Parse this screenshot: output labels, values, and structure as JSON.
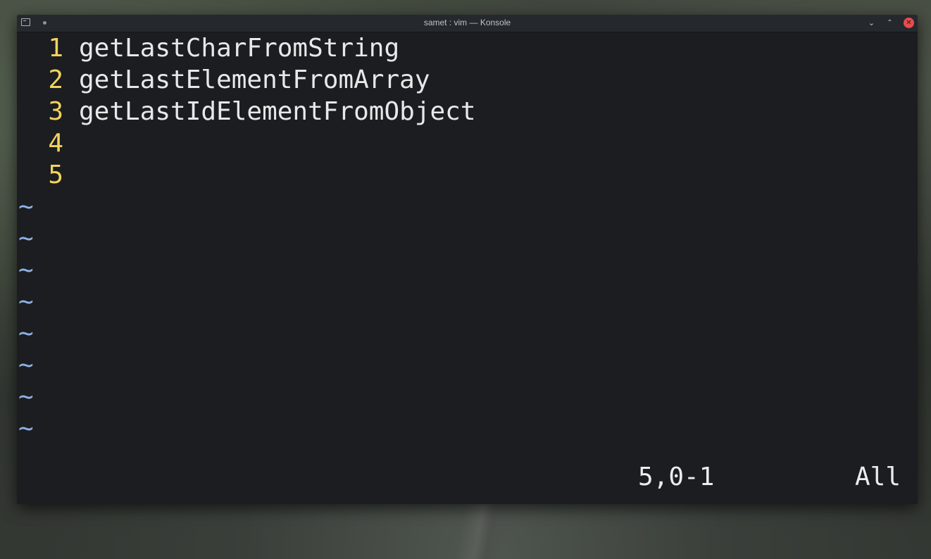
{
  "window": {
    "title": "samet : vim — Konsole",
    "controls": {
      "minimize": "⌄",
      "maximize": "⌃",
      "close": "✕"
    }
  },
  "editor": {
    "lines": [
      {
        "number": "1",
        "text": "getLastCharFromString"
      },
      {
        "number": "2",
        "text": "getLastElementFromArray"
      },
      {
        "number": "3",
        "text": "getLastIdElementFromObject"
      },
      {
        "number": "4",
        "text": ""
      },
      {
        "number": "5",
        "text": ""
      }
    ],
    "filler": [
      "~",
      "~",
      "~",
      "~",
      "~",
      "~",
      "~",
      "~"
    ]
  },
  "ruler": {
    "position": "5,0-1",
    "scroll": "All"
  },
  "colors": {
    "line_number": "#f2d35c",
    "tilde": "#8fb2e8",
    "background": "#1b1d21",
    "close_button": "#e84c4c"
  },
  "icons": [
    "terminal-icon",
    "pin-icon",
    "minimize-icon",
    "maximize-icon",
    "close-icon"
  ]
}
